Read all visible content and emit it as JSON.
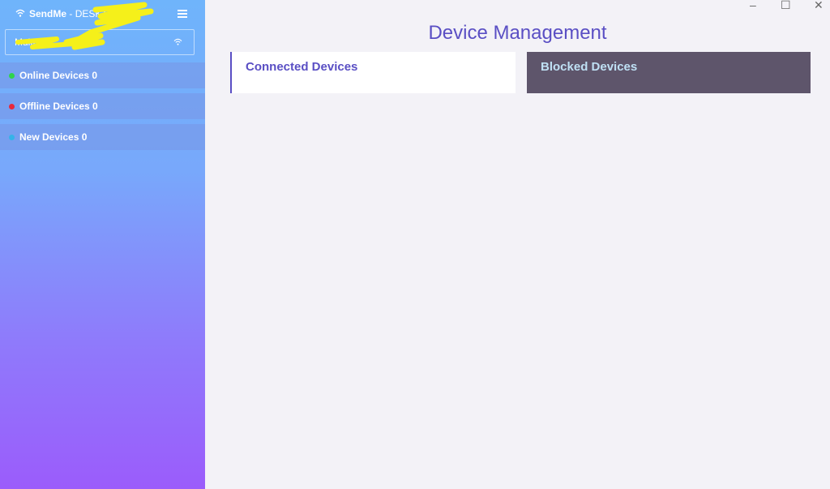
{
  "app": {
    "name": "SendMe",
    "separator": " - ",
    "device": "DESKTOP-"
  },
  "network": {
    "name": "Multi"
  },
  "sidebar": {
    "items": [
      {
        "label": "Online Devices 0",
        "status_color": "#2fd44a"
      },
      {
        "label": "Offline Devices 0",
        "status_color": "#e8283a"
      },
      {
        "label": "New Devices 0",
        "status_color": "#35b3e8"
      }
    ]
  },
  "window": {
    "minimize": "–",
    "maximize": "☐",
    "close": "✕"
  },
  "main": {
    "title": "Device Management",
    "cards": [
      {
        "label": "Connected Devices"
      },
      {
        "label": "Blocked Devices"
      }
    ]
  },
  "colors": {
    "accent": "#5a4fc4",
    "blocked_card": "#5e556b",
    "background": "#f3f2f7",
    "redaction": "#f5f01a"
  }
}
